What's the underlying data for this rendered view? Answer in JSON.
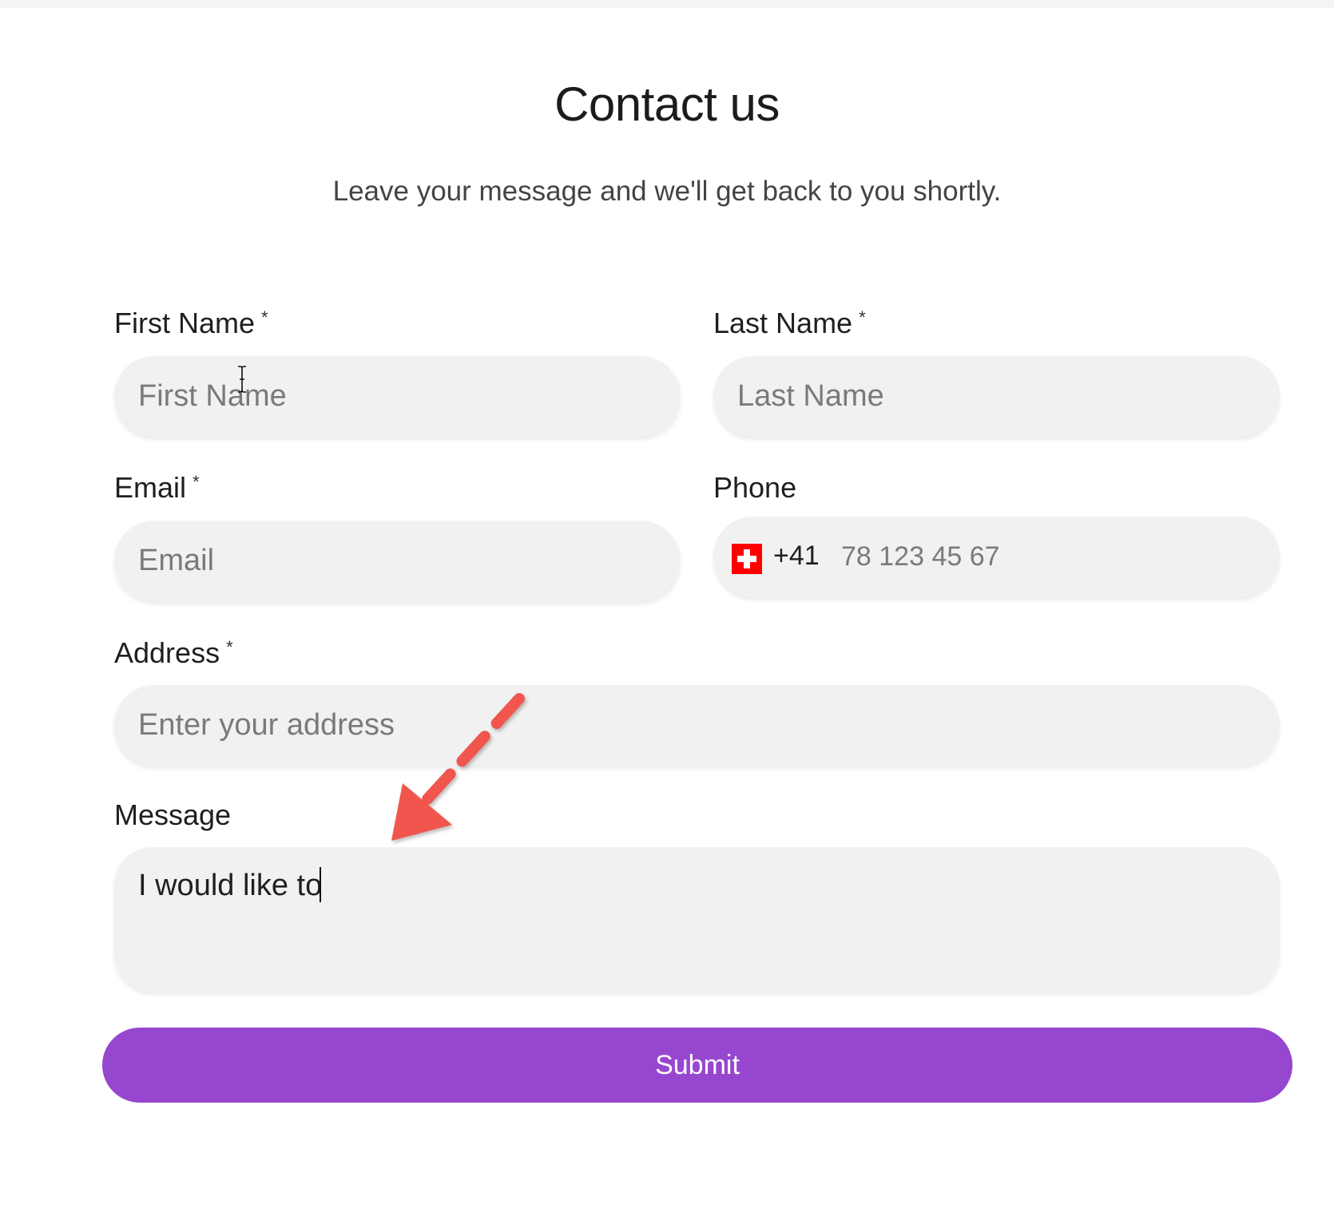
{
  "header": {
    "title": "Contact us",
    "subtitle": "Leave your message and we'll get back to you shortly."
  },
  "form": {
    "first_name": {
      "label": "First Name",
      "required_mark": "*",
      "placeholder": "First Name",
      "value": ""
    },
    "last_name": {
      "label": "Last Name",
      "required_mark": "*",
      "placeholder": "Last Name",
      "value": ""
    },
    "email": {
      "label": "Email",
      "required_mark": "*",
      "placeholder": "Email",
      "value": ""
    },
    "phone": {
      "label": "Phone",
      "country_flag": "switzerland-flag-icon",
      "dial_code": "+41",
      "placeholder": "78 123 45 67",
      "value": ""
    },
    "address": {
      "label": "Address",
      "required_mark": "*",
      "placeholder": "Enter your address",
      "value": ""
    },
    "message": {
      "label": "Message",
      "value": "I would like to"
    },
    "submit_label": "Submit"
  },
  "colors": {
    "accent": "#9747cf",
    "field_background": "#f1f1f1",
    "annotation_arrow": "#f0564d"
  },
  "annotations": {
    "arrow": "dashed-arrow-pointing-to-message",
    "mouse_cursor": "text-ibeam-cursor"
  }
}
